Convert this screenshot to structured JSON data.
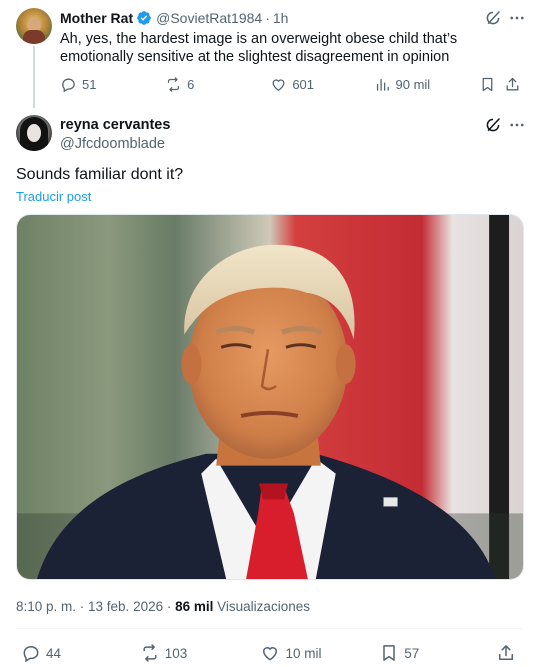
{
  "reply": {
    "display_name": "Mother Rat",
    "handle": "@SovietRat1984",
    "separator": "·",
    "time": "1h",
    "text": "Ah, yes, the hardest image is an overweight obese child that’s emotionally sensitive at the slightest disagreement in opinion",
    "stats": {
      "replies": "51",
      "reposts": "6",
      "likes": "601",
      "views": "90 mil"
    }
  },
  "main": {
    "display_name": "reyna cervantes",
    "handle": "@Jfcdoomblade",
    "text": "Sounds familiar dont it?",
    "translate": "Traducir post",
    "timestamp": "8:10 p. m. · 13 feb. 2026 ·",
    "views_count": "86 mil",
    "views_label": "Visualizaciones",
    "stats": {
      "replies": "44",
      "reposts": "103",
      "likes": "10 mil",
      "bookmarks": "57"
    }
  },
  "icons": {
    "verified": "verified-badge-icon",
    "grok": "grok-icon",
    "more": "more-icon",
    "reply": "reply-icon",
    "repost": "repost-icon",
    "like": "heart-icon",
    "views": "views-icon",
    "bookmark": "bookmark-icon",
    "share": "share-icon"
  },
  "colors": {
    "accent": "#1d9bf0",
    "text": "#0f1419",
    "muted": "#536471",
    "border": "#eff3f4"
  }
}
